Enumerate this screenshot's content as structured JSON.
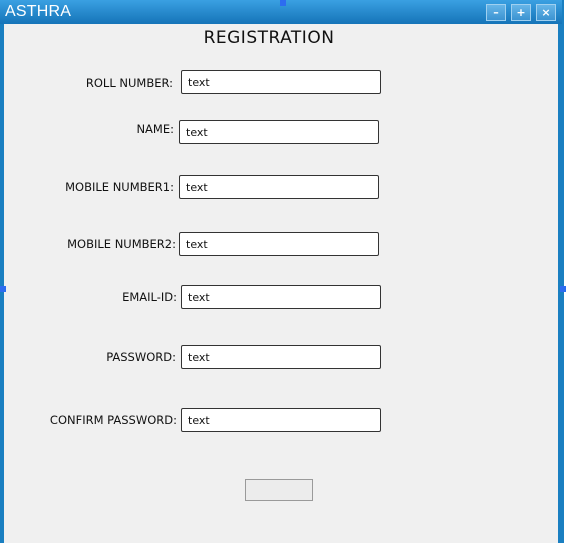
{
  "window": {
    "title": "ASTHRA",
    "buttons": {
      "minimize": "–",
      "maximize": "+",
      "close": "×"
    }
  },
  "form": {
    "heading": "REGISTRATION",
    "fields": {
      "roll_number": {
        "label": "ROLL NUMBER:",
        "value": "text"
      },
      "name": {
        "label": "NAME:",
        "value": "text"
      },
      "mobile1": {
        "label": "MOBILE NUMBER1:",
        "value": "text"
      },
      "mobile2": {
        "label": "MOBILE NUMBER2:",
        "value": "text"
      },
      "email": {
        "label": "EMAIL-ID:",
        "value": "text"
      },
      "password": {
        "label": "PASSWORD:",
        "value": "text"
      },
      "confirm_password": {
        "label": "CONFIRM PASSWORD:",
        "value": "text"
      }
    },
    "submit_label": ""
  }
}
